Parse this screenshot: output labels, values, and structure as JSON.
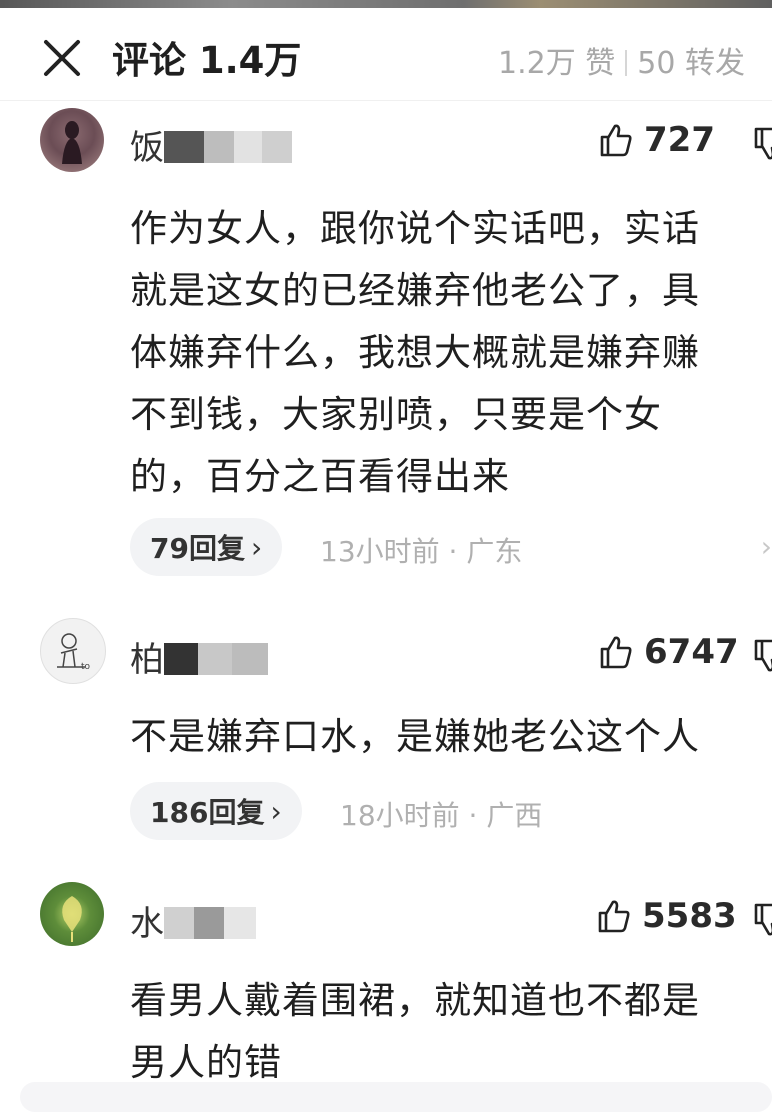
{
  "header": {
    "title": "评论 1.4万",
    "likes": "1.2万 赞",
    "forwards": "50 转发"
  },
  "comments": [
    {
      "username_visible": "饭",
      "likes": "727",
      "text_lines": [
        "作为女人，跟你说个实话吧，实话",
        "就是这女的已经嫌弃他老公了，具",
        "体嫌弃什么，我想大概就是嫌弃赚",
        "不到钱，大家别喷，只要是个女",
        "的，百分之百看得出来"
      ],
      "replies": "79回复",
      "meta": "13小时前 · 广东"
    },
    {
      "username_visible": "柏",
      "likes": "6747",
      "text_lines": [
        "不是嫌弃口水，是嫌她老公这个人"
      ],
      "replies": "186回复",
      "meta": "18小时前 · 广西"
    },
    {
      "username_visible": "水",
      "likes": "5583",
      "text_lines": [
        "看男人戴着围裙，就知道也不都是",
        "男人的错"
      ]
    }
  ],
  "colors": {
    "text": "#1f1f1f",
    "muted": "#b0b0b0",
    "pill_bg": "#f2f3f5"
  }
}
